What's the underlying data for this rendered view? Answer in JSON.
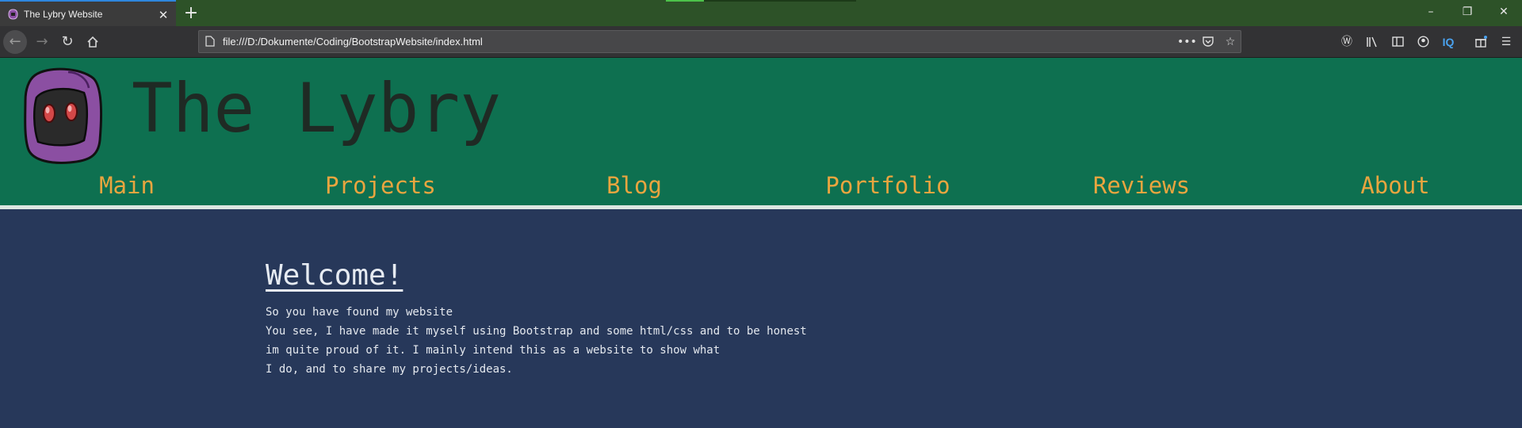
{
  "browser": {
    "tab": {
      "title": "The Lybry Website",
      "favicon": "lybry-favicon-icon"
    },
    "new_tab_label": "+",
    "window_controls": {
      "minimize": "–",
      "restore": "❐",
      "close": "✕"
    },
    "address": "file:///D:/Dokumente/Coding/BootstrapWebsite/index.html",
    "accent_color": "#2e86de",
    "toolbar_icons": [
      "back-icon",
      "forward-icon",
      "reload-icon",
      "home-icon",
      "page-actions-icon",
      "pocket-icon",
      "bookmark-star-icon",
      "extension-icon",
      "library-icon",
      "sidebar-icon",
      "account-icon",
      "iq-extension-icon",
      "gift-icon",
      "menu-icon"
    ],
    "iq_label": "IQ"
  },
  "site": {
    "title": "The Lybry",
    "nav": [
      "Main",
      "Projects",
      "Blog",
      "Portfolio",
      "Reviews",
      "About"
    ],
    "colors": {
      "header_bg": "#0e7050",
      "nav_link": "#e9a53f",
      "page_bg": "#27385a"
    },
    "heading": "Welcome!",
    "lines": [
      "So you have found my website",
      "You see, I have made it myself using Bootstrap and some html/css and to be honest",
      "im quite proud of it. I mainly intend this as a website to show what",
      "I do, and to share my projects/ideas."
    ]
  }
}
